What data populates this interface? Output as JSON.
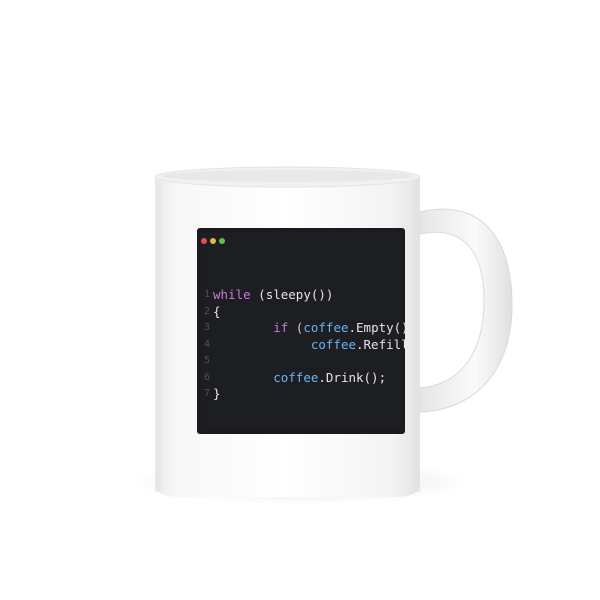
{
  "window_dots": [
    {
      "name": "close-dot",
      "color": "#e2504c"
    },
    {
      "name": "minimize-dot",
      "color": "#e5b83b"
    },
    {
      "name": "maximize-dot",
      "color": "#5ec24a"
    }
  ],
  "code_lines": [
    {
      "number": "1",
      "tokens": [
        {
          "t": "while",
          "c": "kw"
        },
        {
          "t": " (sleepy())",
          "c": "fn"
        }
      ]
    },
    {
      "number": "2",
      "tokens": [
        {
          "t": "{",
          "c": "brace"
        }
      ]
    },
    {
      "number": "3",
      "tokens": [
        {
          "t": "        ",
          "c": "punc"
        },
        {
          "t": "if",
          "c": "kw"
        },
        {
          "t": " (",
          "c": "punc"
        },
        {
          "t": "coffee",
          "c": "obj"
        },
        {
          "t": ".Empty())",
          "c": "fn"
        }
      ]
    },
    {
      "number": "4",
      "tokens": [
        {
          "t": "             ",
          "c": "punc"
        },
        {
          "t": "coffee",
          "c": "obj"
        },
        {
          "t": ".Refill();",
          "c": "fn"
        }
      ]
    },
    {
      "number": "5",
      "tokens": []
    },
    {
      "number": "6",
      "tokens": [
        {
          "t": "        ",
          "c": "punc"
        },
        {
          "t": "coffee",
          "c": "obj"
        },
        {
          "t": ".Drink();",
          "c": "fn"
        }
      ]
    },
    {
      "number": "7",
      "tokens": [
        {
          "t": "}",
          "c": "brace"
        }
      ]
    }
  ],
  "colors": {
    "mug": "#fbfbfb",
    "panel": "#1d1e22"
  }
}
